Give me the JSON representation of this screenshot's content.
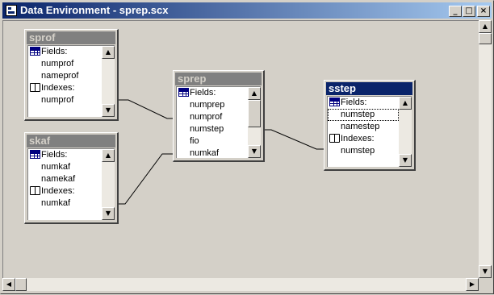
{
  "window": {
    "title": "Data Environment - sprep.scx",
    "controls": {
      "minimize": "_",
      "maximize": "□",
      "close": "×"
    }
  },
  "labels": {
    "fields": "Fields:",
    "indexes": "Indexes:"
  },
  "tables": {
    "sprof": {
      "name": "sprof",
      "fields": [
        "numprof",
        "nameprof"
      ],
      "indexes": [
        "numprof"
      ]
    },
    "skaf": {
      "name": "skaf",
      "fields": [
        "numkaf",
        "namekaf"
      ],
      "indexes": [
        "numkaf"
      ]
    },
    "sprep": {
      "name": "sprep",
      "fields": [
        "numprep",
        "numprof",
        "numstep",
        "fio",
        "numkaf"
      ]
    },
    "sstep": {
      "name": "sstep",
      "fields": [
        "numstep",
        "namestep"
      ],
      "indexes": [
        "numstep"
      ],
      "selected_field": "numstep"
    }
  },
  "colors": {
    "active_title": "#0a246a",
    "inactive_title": "#808080",
    "face": "#d4d0c8"
  },
  "icons": {
    "fields": "table-grid-icon",
    "indexes": "book-icon"
  }
}
